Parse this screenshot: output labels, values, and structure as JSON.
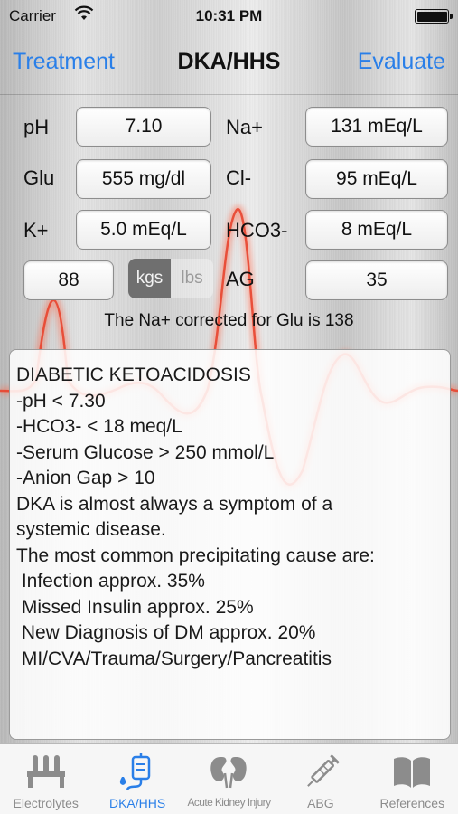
{
  "status": {
    "carrier": "Carrier",
    "time": "10:31 PM"
  },
  "nav": {
    "left": "Treatment",
    "title": "DKA/HHS",
    "right": "Evaluate"
  },
  "fields": {
    "ph": {
      "label": "pH",
      "value": "7.10"
    },
    "na": {
      "label": "Na+",
      "value": "131 mEq/L"
    },
    "glu": {
      "label": "Glu",
      "value": "555 mg/dl"
    },
    "cl": {
      "label": "Cl-",
      "value": "95 mEq/L"
    },
    "k": {
      "label": "K+",
      "value": "5.0 mEq/L"
    },
    "hco3": {
      "label": "HCO3-",
      "value": "8 mEq/L"
    },
    "weight": {
      "value": "88"
    },
    "ag": {
      "label": "AG",
      "value": "35"
    }
  },
  "units": {
    "kgs": "kgs",
    "lbs": "lbs",
    "selected": "kgs"
  },
  "corrected_text": "The Na+ corrected for Glu is 138",
  "panel_lines": [
    "DIABETIC KETOACIDOSIS",
    "",
    "-pH < 7.30",
    "-HCO3- < 18 meq/L",
    "-Serum Glucose > 250 mmol/L",
    "-Anion Gap > 10",
    "",
    "DKA is almost always a symptom of a",
    "systemic disease.",
    "",
    "The most common precipitating cause are:",
    " Infection approx. 35%",
    " Missed Insulin approx. 25%",
    " New Diagnosis of DM approx. 20%",
    " MI/CVA/Trauma/Surgery/Pancreatitis"
  ],
  "tabs": [
    {
      "label": "Electrolytes",
      "icon": "test-tubes-icon",
      "selected": false
    },
    {
      "label": "DKA/HHS",
      "icon": "iv-bag-icon",
      "selected": true
    },
    {
      "label": "Acute Kidney Injury",
      "icon": "kidneys-icon",
      "selected": false
    },
    {
      "label": "ABG",
      "icon": "syringe-icon",
      "selected": false
    },
    {
      "label": "References",
      "icon": "book-icon",
      "selected": false
    }
  ],
  "colors": {
    "accent": "#2a7fe8",
    "ecg": "#e8442e",
    "tab_inactive": "#8c8c8c"
  }
}
